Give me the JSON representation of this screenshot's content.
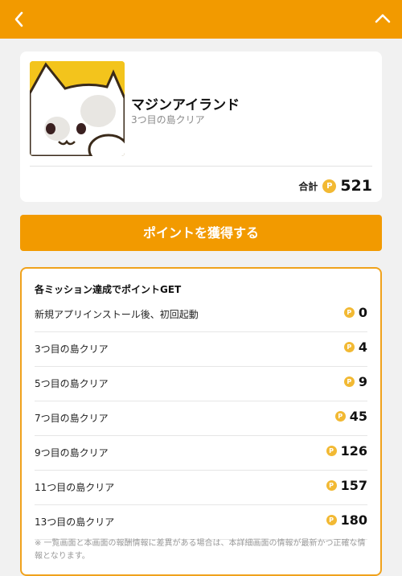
{
  "header": {
    "back_icon": "chevron-left-icon",
    "collapse_icon": "chevron-up-icon"
  },
  "app": {
    "name": "マジンアイランド",
    "subtitle": "3つ目の島クリア",
    "total_label": "合計",
    "coin_symbol": "P",
    "total_points": "521"
  },
  "cta": {
    "label": "ポイントを獲得する"
  },
  "missions": {
    "title": "各ミッション達成でポイントGET",
    "items": [
      {
        "label": "新規アプリインストール後、初回起動",
        "points": "0"
      },
      {
        "label": "3つ目の島クリア",
        "points": "4"
      },
      {
        "label": "5つ目の島クリア",
        "points": "9"
      },
      {
        "label": "7つ目の島クリア",
        "points": "45"
      },
      {
        "label": "9つ目の島クリア",
        "points": "126"
      },
      {
        "label": "11つ目の島クリア",
        "points": "157"
      },
      {
        "label": "13つ目の島クリア",
        "points": "180"
      }
    ],
    "note": "※ 一覧画面と本画面の報酬情報に差異がある場合は、本詳細画面の情報が最新かつ正確な情報となります。"
  },
  "colors": {
    "brand": "#f29a00",
    "coin": "#f2b933",
    "border": "#f0a21c"
  }
}
